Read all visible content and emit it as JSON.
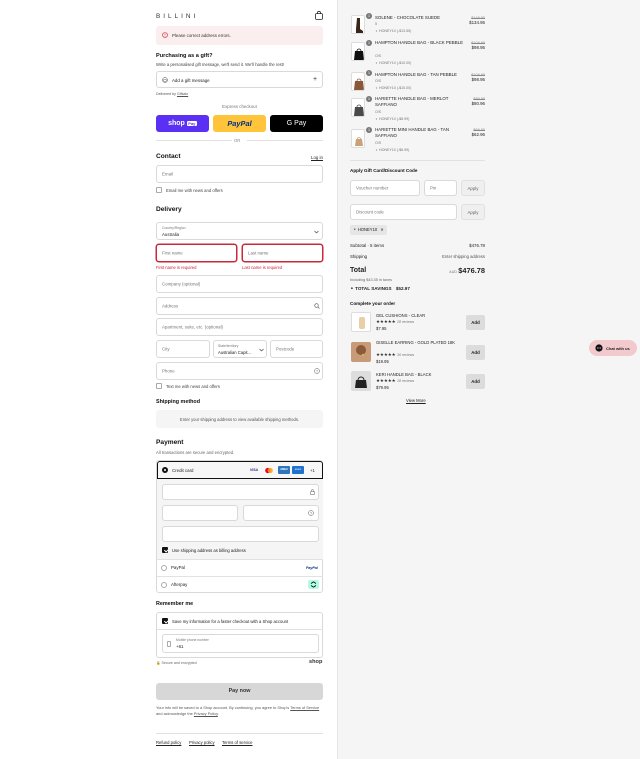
{
  "brand": {
    "logo": "BILLINI"
  },
  "alert": {
    "text": "Please correct address errors."
  },
  "gift": {
    "title": "Purchasing as a gift?",
    "subtitle": "Write a personalised gift message, we'll send it. We'll handle the rest!",
    "add_label": "Add a gift message",
    "delivered_by": "Delivered by",
    "delivered_link": "Gifkalo"
  },
  "express": {
    "title": "Express checkout",
    "shop_label": "shop",
    "shop_pay_tag": "Pay",
    "paypal_label": "PayPal",
    "gpay_label": "G Pay",
    "or": "OR"
  },
  "contact": {
    "title": "Contact",
    "login": "Log in",
    "email_placeholder": "Email",
    "news_label": "Email me with news and offers"
  },
  "delivery": {
    "title": "Delivery",
    "country_label": "Country/Region",
    "country_value": "Australia",
    "first_name_placeholder": "First name",
    "last_name_placeholder": "Last name",
    "first_name_error": "First name is required",
    "last_name_error": "Last name is required",
    "company_placeholder": "Company (optional)",
    "address_placeholder": "Address",
    "apartment_placeholder": "Apartment, suite, etc. (optional)",
    "city_placeholder": "City",
    "state_label": "State/territory",
    "state_value": "Australian Capit...",
    "postcode_placeholder": "Postcode",
    "phone_placeholder": "Phone",
    "text_label": "Text me with news and offers"
  },
  "shipping": {
    "title": "Shipping method",
    "placeholder": "Enter your shipping address to view available shipping methods."
  },
  "payment": {
    "title": "Payment",
    "subtitle": "All transactions are secure and encrypted.",
    "credit_card": "Credit card",
    "more_cards": "+1",
    "card_icons": [
      "VISA",
      "mastercard",
      "AMEX",
      "amex"
    ],
    "billing_label": "Use shipping address as billing address",
    "paypal": "PayPal",
    "paypal_logo": "PayPal",
    "afterpay": "Afterpay"
  },
  "remember": {
    "title": "Remember me",
    "save_label": "Save my information for a faster checkout with a Shop account",
    "mobile_label": "Mobile phone number",
    "mobile_value": "+61",
    "secure": "Secure and encrypted",
    "shop_logo": "shop"
  },
  "paynow": {
    "label": "Pay now",
    "terms_1": "Your info will be saved to a Shop account. By continuing, you agree to Shop's",
    "terms_link1": "Terms of Service",
    "terms_2": "and acknowledge the",
    "terms_link2": "Privacy Policy",
    "terms_3": "."
  },
  "footer": {
    "refund": "Refund policy",
    "privacy": "Privacy policy",
    "terms": "Terms of service"
  },
  "cart": {
    "items": [
      {
        "qty": "1",
        "name": "SOLENE - CHOCOLATE SUEDE",
        "variant": "5",
        "discount": "HONEY10 (-$13.55)",
        "old": "$149.95",
        "price": "$134.95"
      },
      {
        "qty": "1",
        "name": "HAMPTON HANDLE BAG - BLACK PEBBLE",
        "variant": "O/S",
        "discount": "HONEY10 (-$10.00)",
        "old": "$109.95",
        "price": "$98.95"
      },
      {
        "qty": "1",
        "name": "HAMPTON HANDLE BAG - TAN PEBBLE",
        "variant": "O/S",
        "discount": "HONEY10 (-$10.00)",
        "old": "$109.95",
        "price": "$98.95"
      },
      {
        "qty": "1",
        "name": "HARIETTE HANDLE BAG - MERLOT SAFFIANO",
        "variant": "O/S",
        "discount": "HONEY10 (-$8.99)",
        "old": "$89.95",
        "price": "$80.96"
      },
      {
        "qty": "1",
        "name": "HARIETTE MINI HANDLE BAG - TAN SAFFIANO",
        "variant": "O/S",
        "discount": "HONEY10 (-$6.99)",
        "old": "$69.95",
        "price": "$62.96"
      }
    ],
    "gift_card_title": "Apply Gift Card/Discount Code",
    "voucher_placeholder": "Voucher number",
    "pin_placeholder": "Pin",
    "apply": "Apply",
    "discount_placeholder": "Discount code",
    "applied_code": "HONEY10",
    "subtotal_label": "Subtotal · 5 items",
    "subtotal_value": "$476.78",
    "shipping_label": "Shipping",
    "shipping_value": "Enter shipping address",
    "total_label": "Total",
    "currency": "AUD",
    "total_value": "$476.78",
    "taxes": "Including $43.35 in taxes",
    "savings_label": "TOTAL SAVINGS",
    "savings_value": "$52.97"
  },
  "complete": {
    "title": "Complete your order",
    "items": [
      {
        "name": "GEL CUSHIONS - CLEAR",
        "stars": "★★★★★",
        "reviews": "28 reviews",
        "price": "$7.95"
      },
      {
        "name": "GISELLE EARRING - GOLD PLATED 18K",
        "stars": "★★★★★",
        "reviews": "36 reviews",
        "price": "$19.95"
      },
      {
        "name": "KERI HANDLE BAG - BLACK",
        "stars": "★★★★★",
        "reviews": "18 reviews",
        "price": "$79.95"
      }
    ],
    "add": "Add",
    "view_more": "View More"
  },
  "chat": {
    "label": "Chat with us"
  }
}
